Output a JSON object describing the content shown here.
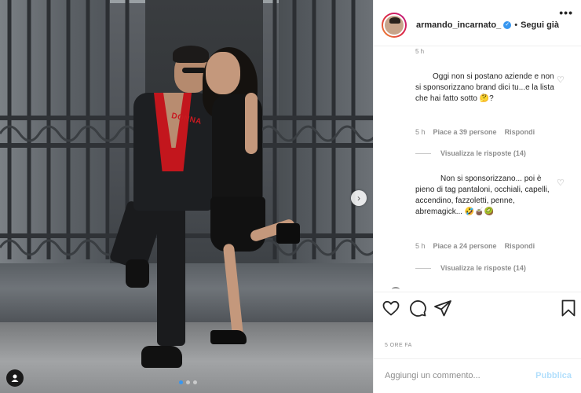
{
  "post": {
    "username": "armando_incarnato_",
    "follow_label": "Segui già",
    "separator": "•",
    "more_label": "•••",
    "verified_mark": "✓",
    "photo_overlay_text": "DONNA",
    "carousel": {
      "current": 1,
      "total": 3
    }
  },
  "comments": {
    "top_time": "5 h",
    "items": [
      {
        "text": "Oggi non si postano aziende e non si sponsorizzano brand dici tu...e la lista che hai fatto sotto 🤔?",
        "time": "5 h",
        "likes": "Piace a 39 persone",
        "reply": "Rispondi",
        "replies": "Visualizza le risposte (14)"
      },
      {
        "text": "Non si sponsorizzano... poi è pieno di tag pantaloni, occhiali, capelli, accendino, fazzoletti, penne, abremagick... 🤣🧉🥝",
        "time": "5 h",
        "likes": "Piace a 24 persone",
        "reply": "Rispondi",
        "replies": "Visualizza le risposte (14)"
      }
    ]
  },
  "footer": {
    "time": "5 ore fa",
    "add_comment_placeholder": "Aggiungi un commento...",
    "publish_label": "Pubblica"
  },
  "icons": {
    "heart": "heart-icon",
    "comment": "comment-icon",
    "share": "share-icon",
    "save": "bookmark-icon",
    "next": "chevron-right-icon",
    "tag_user": "user-icon"
  },
  "colors": {
    "accent_blue": "#3897f0",
    "publish_disabled": "#b2dffc",
    "muted": "#8e8e8e"
  }
}
